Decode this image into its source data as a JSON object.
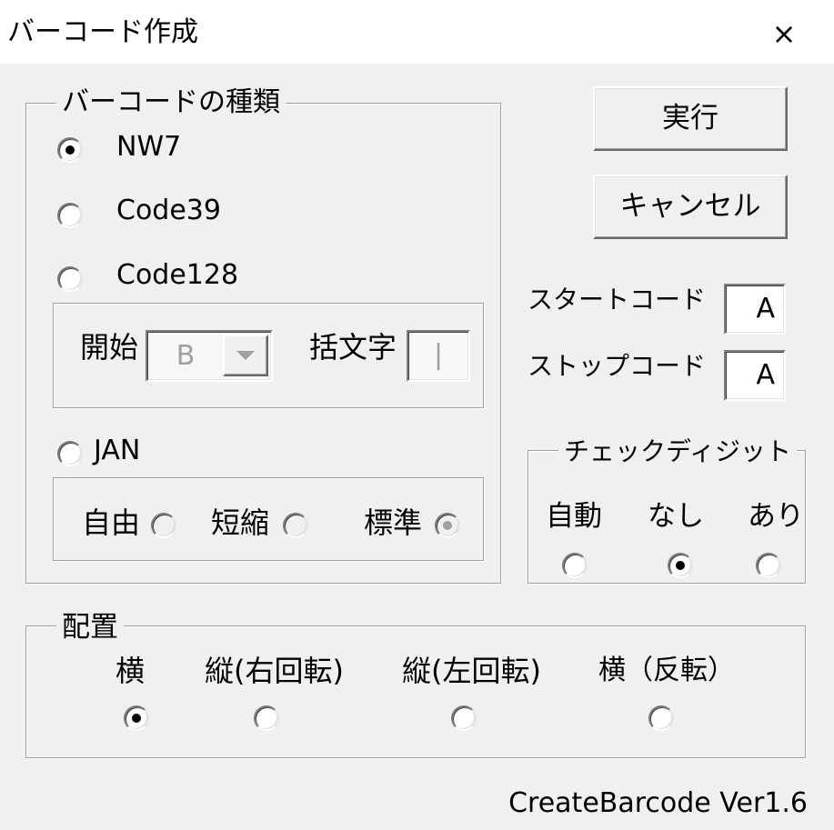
{
  "window": {
    "title": "バーコード作成",
    "close_glyph": "×"
  },
  "icons": {
    "close": "close-icon",
    "dropdown": "triangle-down-icon"
  },
  "colors": {
    "title_bg": "#ffffff",
    "window_bg": "#f0f0f0",
    "text": "#000000",
    "disabled_text": "#a0a0a0"
  },
  "barcode_type": {
    "legend": "バーコードの種類",
    "options": [
      {
        "label": "NW7",
        "checked": true
      },
      {
        "label": "Code39",
        "checked": false
      },
      {
        "label": "Code128",
        "checked": false
      },
      {
        "label": "JAN",
        "checked": false
      }
    ],
    "code128": {
      "disabled": true,
      "start_label": "開始",
      "start_value": "B",
      "bracket_label": "括文字",
      "bracket_value": "|"
    },
    "jan": {
      "options": [
        {
          "label": "自由",
          "checked": false,
          "disabled": true
        },
        {
          "label": "短縮",
          "checked": false,
          "disabled": true
        },
        {
          "label": "標準",
          "checked": true,
          "disabled": true
        }
      ]
    }
  },
  "buttons": {
    "run": "実行",
    "cancel": "キャンセル"
  },
  "start_code": {
    "label": "スタートコード",
    "value": "A"
  },
  "stop_code": {
    "label": "ストップコード",
    "value": "A"
  },
  "check_digit": {
    "legend": "チェックディジット",
    "options": [
      {
        "label": "自動",
        "checked": false
      },
      {
        "label": "なし",
        "checked": true
      },
      {
        "label": "あり",
        "checked": false
      }
    ]
  },
  "placement": {
    "legend": "配置",
    "options": [
      {
        "label": "横",
        "checked": true
      },
      {
        "label": "縦(右回転)",
        "checked": false
      },
      {
        "label": "縦(左回転)",
        "checked": false
      },
      {
        "label": "横（反転）",
        "checked": false
      }
    ]
  },
  "footer": {
    "version": "CreateBarcode Ver1.6"
  }
}
